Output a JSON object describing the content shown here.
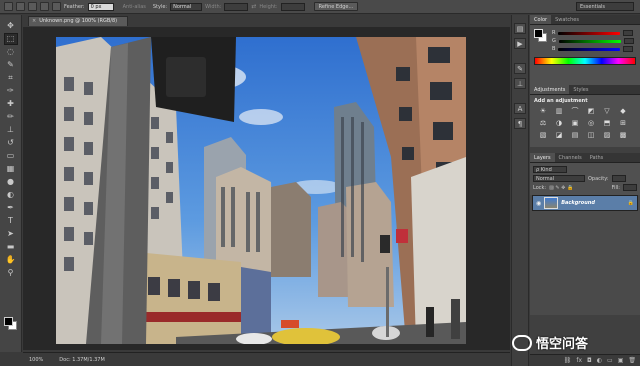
{
  "options_bar": {
    "feather_label": "Feather:",
    "feather_value": "0 px",
    "antialias_label": "Anti-alias",
    "style_label": "Style:",
    "style_value": "Normal",
    "width_label": "Width:",
    "height_label": "Height:",
    "refine_edge_label": "Refine Edge...",
    "workspace": "Essentials"
  },
  "document": {
    "tab_title": "Unknown.png @ 100% (RGB/8)",
    "close_glyph": "×",
    "zoom": "100%",
    "doc_info": "Doc: 1.37M/1.37M"
  },
  "tools": [
    {
      "icon": "move-icon",
      "glyph": "✥"
    },
    {
      "icon": "marquee-icon",
      "glyph": "⬚"
    },
    {
      "icon": "lasso-icon",
      "glyph": "◌"
    },
    {
      "icon": "quick-select-icon",
      "glyph": "✎"
    },
    {
      "icon": "crop-icon",
      "glyph": "⌗"
    },
    {
      "icon": "eyedropper-icon",
      "glyph": "✑"
    },
    {
      "icon": "healing-brush-icon",
      "glyph": "✚"
    },
    {
      "icon": "brush-icon",
      "glyph": "✏"
    },
    {
      "icon": "clone-stamp-icon",
      "glyph": "⊥"
    },
    {
      "icon": "history-brush-icon",
      "glyph": "↺"
    },
    {
      "icon": "eraser-icon",
      "glyph": "▭"
    },
    {
      "icon": "gradient-icon",
      "glyph": "▦"
    },
    {
      "icon": "blur-icon",
      "glyph": "●"
    },
    {
      "icon": "dodge-icon",
      "glyph": "◐"
    },
    {
      "icon": "pen-icon",
      "glyph": "✒"
    },
    {
      "icon": "type-icon",
      "glyph": "T"
    },
    {
      "icon": "path-select-icon",
      "glyph": "➤"
    },
    {
      "icon": "shape-icon",
      "glyph": "▬"
    },
    {
      "icon": "hand-icon",
      "glyph": "✋"
    },
    {
      "icon": "zoom-icon",
      "glyph": "⚲"
    }
  ],
  "panels": {
    "color_tab": "Color",
    "swatches_tab": "Swatches",
    "r_label": "R",
    "g_label": "G",
    "b_label": "B",
    "adjustments_tab": "Adjustments",
    "styles_tab": "Styles",
    "add_adjustment": "Add an adjustment",
    "layers_tab": "Layers",
    "channels_tab": "Channels",
    "paths_tab": "Paths",
    "kind_label": "ρ Kind",
    "blend_mode": "Normal",
    "opacity_label": "Opacity:",
    "lock_label": "Lock:",
    "fill_label": "Fill:",
    "layer_name": "Background"
  },
  "adjustment_icons": [
    "☀",
    "▥",
    "⌒",
    "◩",
    "▽",
    "◆",
    "⚖",
    "◑",
    "▣",
    "◎",
    "⬒",
    "⊞",
    "▧",
    "◪",
    "▤",
    "◫",
    "▨",
    "▩"
  ],
  "watermark": {
    "text": "悟空问答"
  },
  "colors": {
    "fg": "#000000",
    "bg": "#ffffff",
    "accent_selected_layer": "#5b7ea8"
  }
}
